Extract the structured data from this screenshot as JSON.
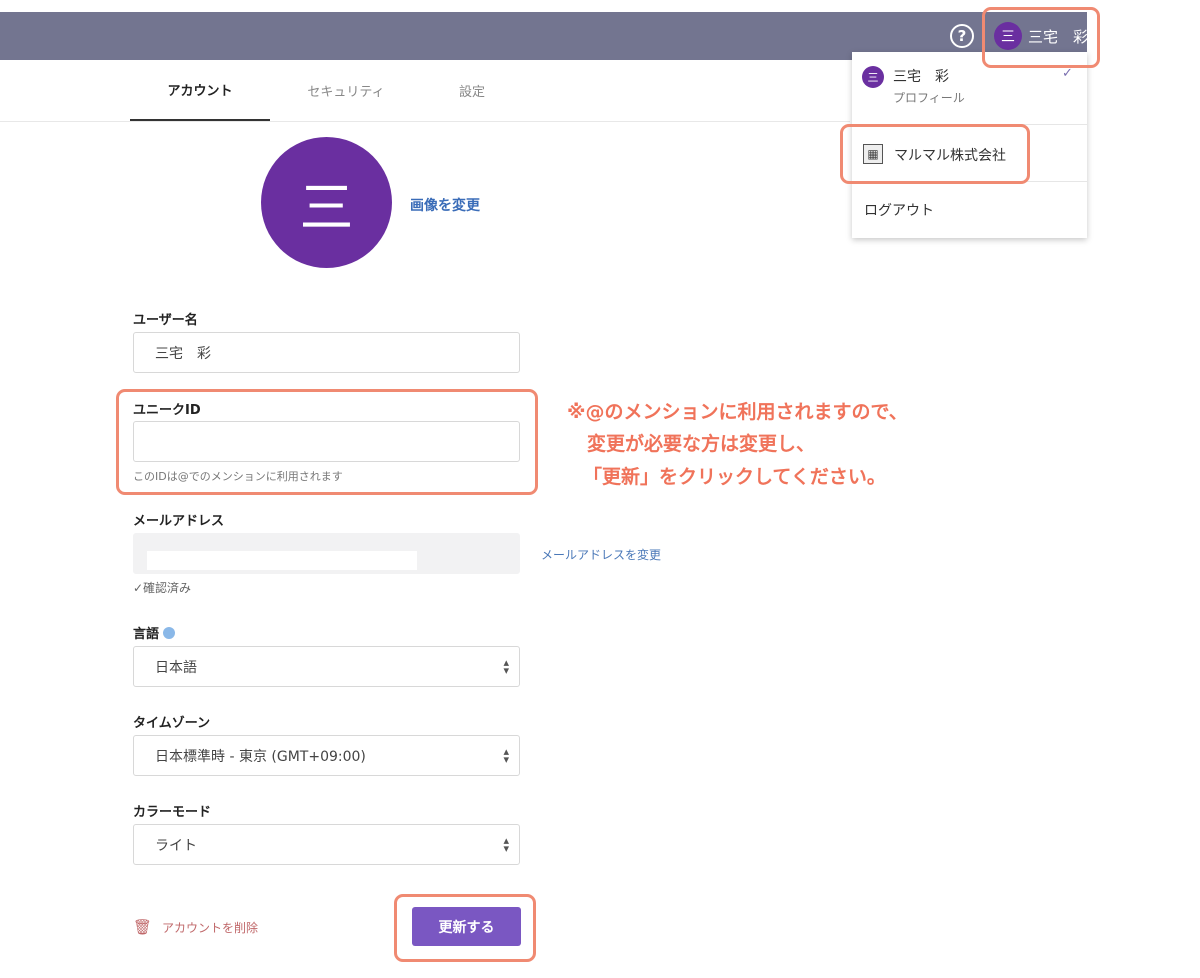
{
  "header": {
    "help_symbol": "?",
    "user_initial": "三",
    "user_name": "三宅　彩"
  },
  "tabs": [
    {
      "label": "アカウント",
      "active": true
    },
    {
      "label": "セキュリティ",
      "active": false
    },
    {
      "label": "設定",
      "active": false
    }
  ],
  "dropdown": {
    "avatar_initial": "三",
    "name": "三宅　彩",
    "subtitle": "プロフィール",
    "check": "✓",
    "organization": "マルマル株式会社",
    "logout": "ログアウト"
  },
  "profile": {
    "avatar_initial": "三",
    "change_image": "画像を変更"
  },
  "form": {
    "username_label": "ユーザー名",
    "username_value": "三宅　彩",
    "unique_id_label": "ユニークID",
    "unique_id_value": "",
    "unique_id_hint": "このIDは@でのメンションに利用されます",
    "email_label": "メールアドレス",
    "email_change_link": "メールアドレスを変更",
    "email_verified": "✓確認済み",
    "language_label": "言語",
    "language_value": "日本語",
    "timezone_label": "タイムゾーン",
    "timezone_value": "日本標準時 - 東京 (GMT+09:00)",
    "color_mode_label": "カラーモード",
    "color_mode_value": "ライト"
  },
  "annotation": {
    "line1": "※@のメンションに利用されますので、",
    "line2": "変更が必要な方は変更し、",
    "line3": "「更新」をクリックしてください。"
  },
  "actions": {
    "delete_account": "アカウントを削除",
    "update": "更新する"
  },
  "colors": {
    "topbar": "#737590",
    "avatar": "#6a2fa0",
    "primary_button": "#7a57c2",
    "highlight": "#f08a72",
    "annotation_text": "#f0735a"
  }
}
